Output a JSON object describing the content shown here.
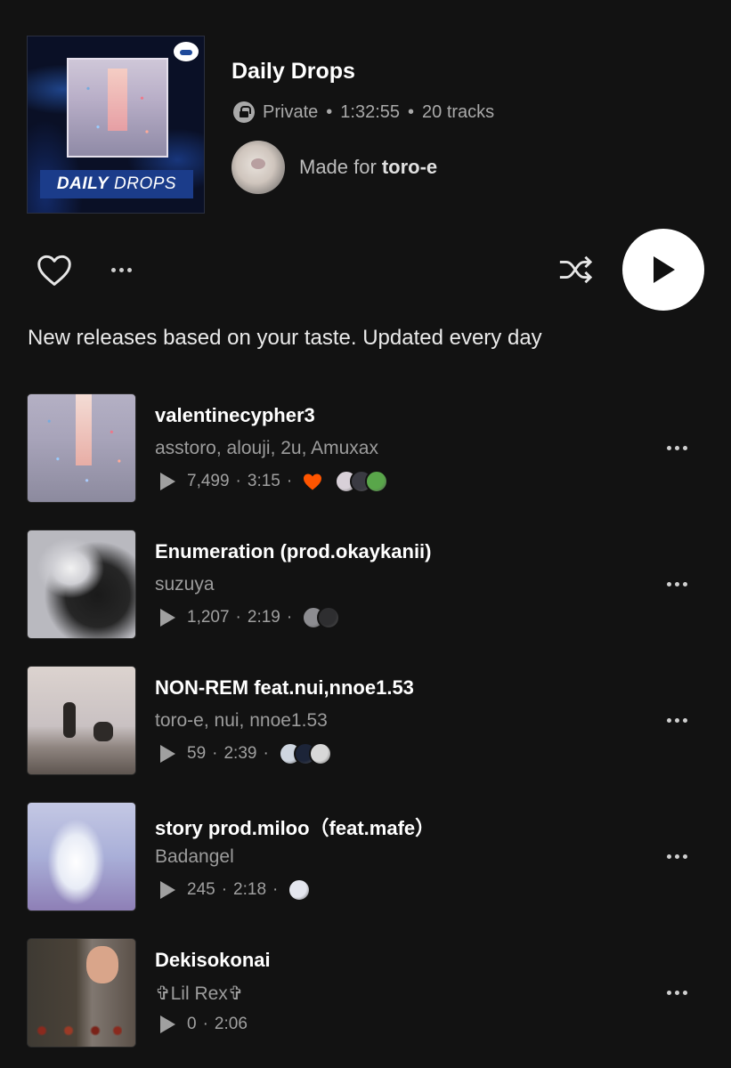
{
  "playlist": {
    "cover_text_bold": "DAILY",
    "cover_text_thin": "DROPS",
    "title": "Daily Drops",
    "privacy": "Private",
    "duration": "1:32:55",
    "track_count": "20 tracks",
    "made_for_label": "Made for",
    "made_for_user": "toro-e",
    "description": "New releases based on your taste. Updated every day"
  },
  "separators": {
    "dot": "•",
    "mid": "·"
  },
  "colors": {
    "background": "#121212",
    "accent_heart": "#ff5500",
    "play_button": "#ffffff"
  },
  "tracks": [
    {
      "title": "valentinecypher3",
      "artists": "asstoro, alouji, 2u, Amuxax",
      "plays": "7,499",
      "duration": "3:15",
      "liked": true,
      "avatar_colors": [
        "#d8d0d8",
        "#3a3a42",
        "#59a64a"
      ]
    },
    {
      "title": "Enumeration (prod.okaykanii)",
      "artists": "suzuya",
      "plays": "1,207",
      "duration": "2:19",
      "liked": false,
      "avatar_colors": [
        "#8c8c90",
        "#2e2e30"
      ]
    },
    {
      "title": "NON-REM feat.nui,nnoe1.53",
      "artists": "toro-e, nui, nnoe1.53",
      "plays": "59",
      "duration": "2:39",
      "liked": false,
      "avatar_colors": [
        "#cfd6e0",
        "#1c2438",
        "#d8d8d8"
      ]
    },
    {
      "title": "story prod.miloo（feat.mafe）",
      "artists": "Badangel",
      "plays": "245",
      "duration": "2:18",
      "liked": false,
      "avatar_colors": [
        "#e4e6ee"
      ]
    },
    {
      "title": "Dekisokonai",
      "artists": "✞Lil Rex✞",
      "plays": "0",
      "duration": "2:06",
      "liked": false,
      "avatar_colors": []
    }
  ]
}
